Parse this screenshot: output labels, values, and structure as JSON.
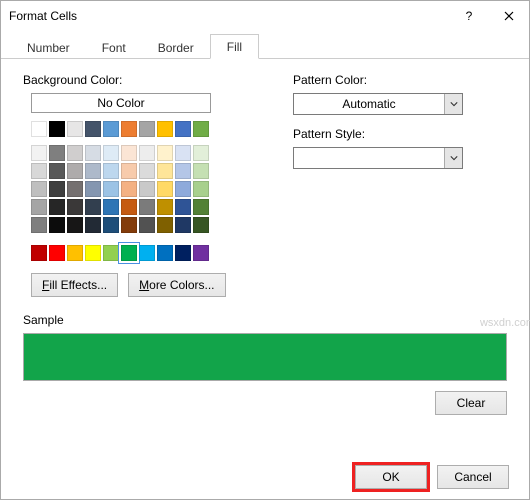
{
  "dialog": {
    "title": "Format Cells"
  },
  "tabs": {
    "l0": "Number",
    "l1": "Font",
    "l2": "Border",
    "l3": "Fill",
    "active": 3
  },
  "fill": {
    "bgLabel": "Background Color:",
    "noColor": "No Color",
    "effects": "Fill Effects...",
    "moreColors": "More Colors...",
    "patternColorLabel": "Pattern Color:",
    "patternColorValue": "Automatic",
    "patternStyleLabel": "Pattern Style:",
    "patternStyleValue": "",
    "palette": {
      "row1": [
        "#ffffff",
        "#000000",
        "#e7e6e6",
        "#44546a",
        "#5b9bd5",
        "#ed7d31",
        "#a5a5a5",
        "#ffc000",
        "#4472c4",
        "#70ad47"
      ],
      "row2": [
        "#f2f2f2",
        "#7f7f7f",
        "#d0cece",
        "#d6dce4",
        "#deebf6",
        "#fbe5d5",
        "#ededed",
        "#fff2cc",
        "#d9e2f3",
        "#e2efd9"
      ],
      "row3": [
        "#d8d8d8",
        "#595959",
        "#aeabab",
        "#adb9ca",
        "#bdd7ee",
        "#f7cbac",
        "#dbdbdb",
        "#fee599",
        "#b4c6e7",
        "#c5e0b3"
      ],
      "row4": [
        "#bfbfbf",
        "#3f3f3f",
        "#757070",
        "#8496b0",
        "#9cc3e5",
        "#f4b183",
        "#c9c9c9",
        "#ffd965",
        "#8eaadb",
        "#a8d08d"
      ],
      "row5": [
        "#a5a5a5",
        "#262626",
        "#3a3838",
        "#323f4f",
        "#2e75b5",
        "#c55a11",
        "#7b7b7b",
        "#bf9000",
        "#2f5496",
        "#538135"
      ],
      "row6": [
        "#7f7f7f",
        "#0c0c0c",
        "#171616",
        "#222a35",
        "#1e4e79",
        "#833c0b",
        "#525252",
        "#7f6000",
        "#1f3864",
        "#375623"
      ],
      "std": [
        "#c00000",
        "#ff0000",
        "#ffc000",
        "#ffff00",
        "#92d050",
        "#00b050",
        "#00b0f0",
        "#0070c0",
        "#002060",
        "#7030a0"
      ],
      "selected": "#00b050"
    }
  },
  "sample": {
    "label": "Sample",
    "color": "#12a44a"
  },
  "buttons": {
    "clear": "Clear",
    "ok": "OK",
    "cancel": "Cancel"
  },
  "watermark": "wsxdn.com"
}
